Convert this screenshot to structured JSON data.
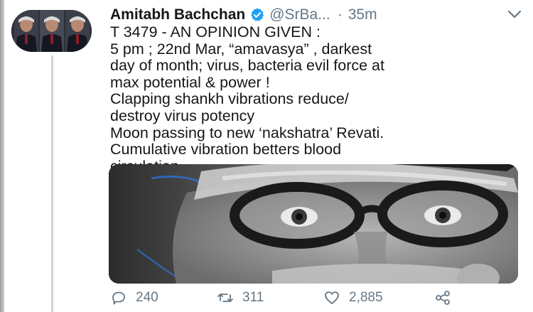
{
  "tweet": {
    "author_name": "Amitabh Bachchan",
    "handle": "@SrBa...",
    "separator": "·",
    "time": "35m",
    "lines": [
      "T 3479 - AN OPINION GIVEN :",
      "5 pm ; 22nd Mar, “amavasya” , darkest",
      "day of month; virus, bacteria evil force at",
      "max potential & power !",
      "Clapping shankh vibrations reduce/",
      "destroy virus potency",
      "Moon passing to new ‘nakshatra’ Revati.",
      "Cumulative vibration betters blood",
      "circulation"
    ]
  },
  "actions": {
    "replies": "240",
    "retweets": "311",
    "likes": "2,885"
  },
  "icons": {
    "verified": "verified-badge-icon",
    "more": "chevron-down-icon",
    "reply": "reply-icon",
    "retweet": "retweet-icon",
    "like": "heart-icon",
    "share": "share-icon"
  },
  "colors": {
    "text": "#14171a",
    "muted": "#657786",
    "verified": "#1da1f2",
    "thread_line": "#ccd6dd"
  }
}
